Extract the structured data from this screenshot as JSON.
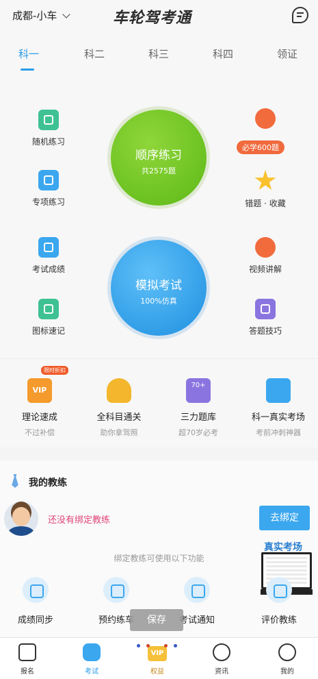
{
  "header": {
    "city": "成都-小车",
    "logo": "车轮驾考通"
  },
  "tabs": [
    "科一",
    "科二",
    "科三",
    "科四",
    "领证"
  ],
  "features": {
    "random": "随机练习",
    "special": "专项练习",
    "exam_score": "考试成绩",
    "icon_memory": "图标速记",
    "must_learn_badge": "必学600题",
    "wrong_collect": "错题 · 收藏",
    "video": "视频讲解",
    "tips": "答题技巧"
  },
  "circles": {
    "sequence": {
      "title": "顺序练习",
      "sub": "共2575题"
    },
    "mock": {
      "title": "模拟考试",
      "sub": "100%仿真"
    }
  },
  "row2": [
    {
      "label": "理论速成",
      "sub": "不过补偿"
    },
    {
      "label": "全科目通关",
      "sub": "助你拿驾照"
    },
    {
      "label": "三力题库",
      "sub": "超70岁必考"
    },
    {
      "label": "科一真实考场",
      "sub": "考前冲刺神器"
    }
  ],
  "row2_badge": "限时折扣",
  "row2_icon_text": {
    "vip": "VIP",
    "seventy": "70+"
  },
  "coach": {
    "title": "我的教练",
    "empty": "还没有绑定教练",
    "bind_button": "去绑定",
    "hint": "绑定教练可使用以下功能",
    "real_test": "真实考场",
    "features": [
      "成绩同步",
      "预约练车",
      "考试通知",
      "评价教练"
    ]
  },
  "toast": "保存",
  "tabbar": [
    "报名",
    "考试",
    "权益",
    "资讯",
    "我的"
  ],
  "vip_icon_text": "VIP",
  "colors": {
    "accent": "#2a9be8",
    "green": "#5cb917",
    "pink": "#e0457b"
  }
}
